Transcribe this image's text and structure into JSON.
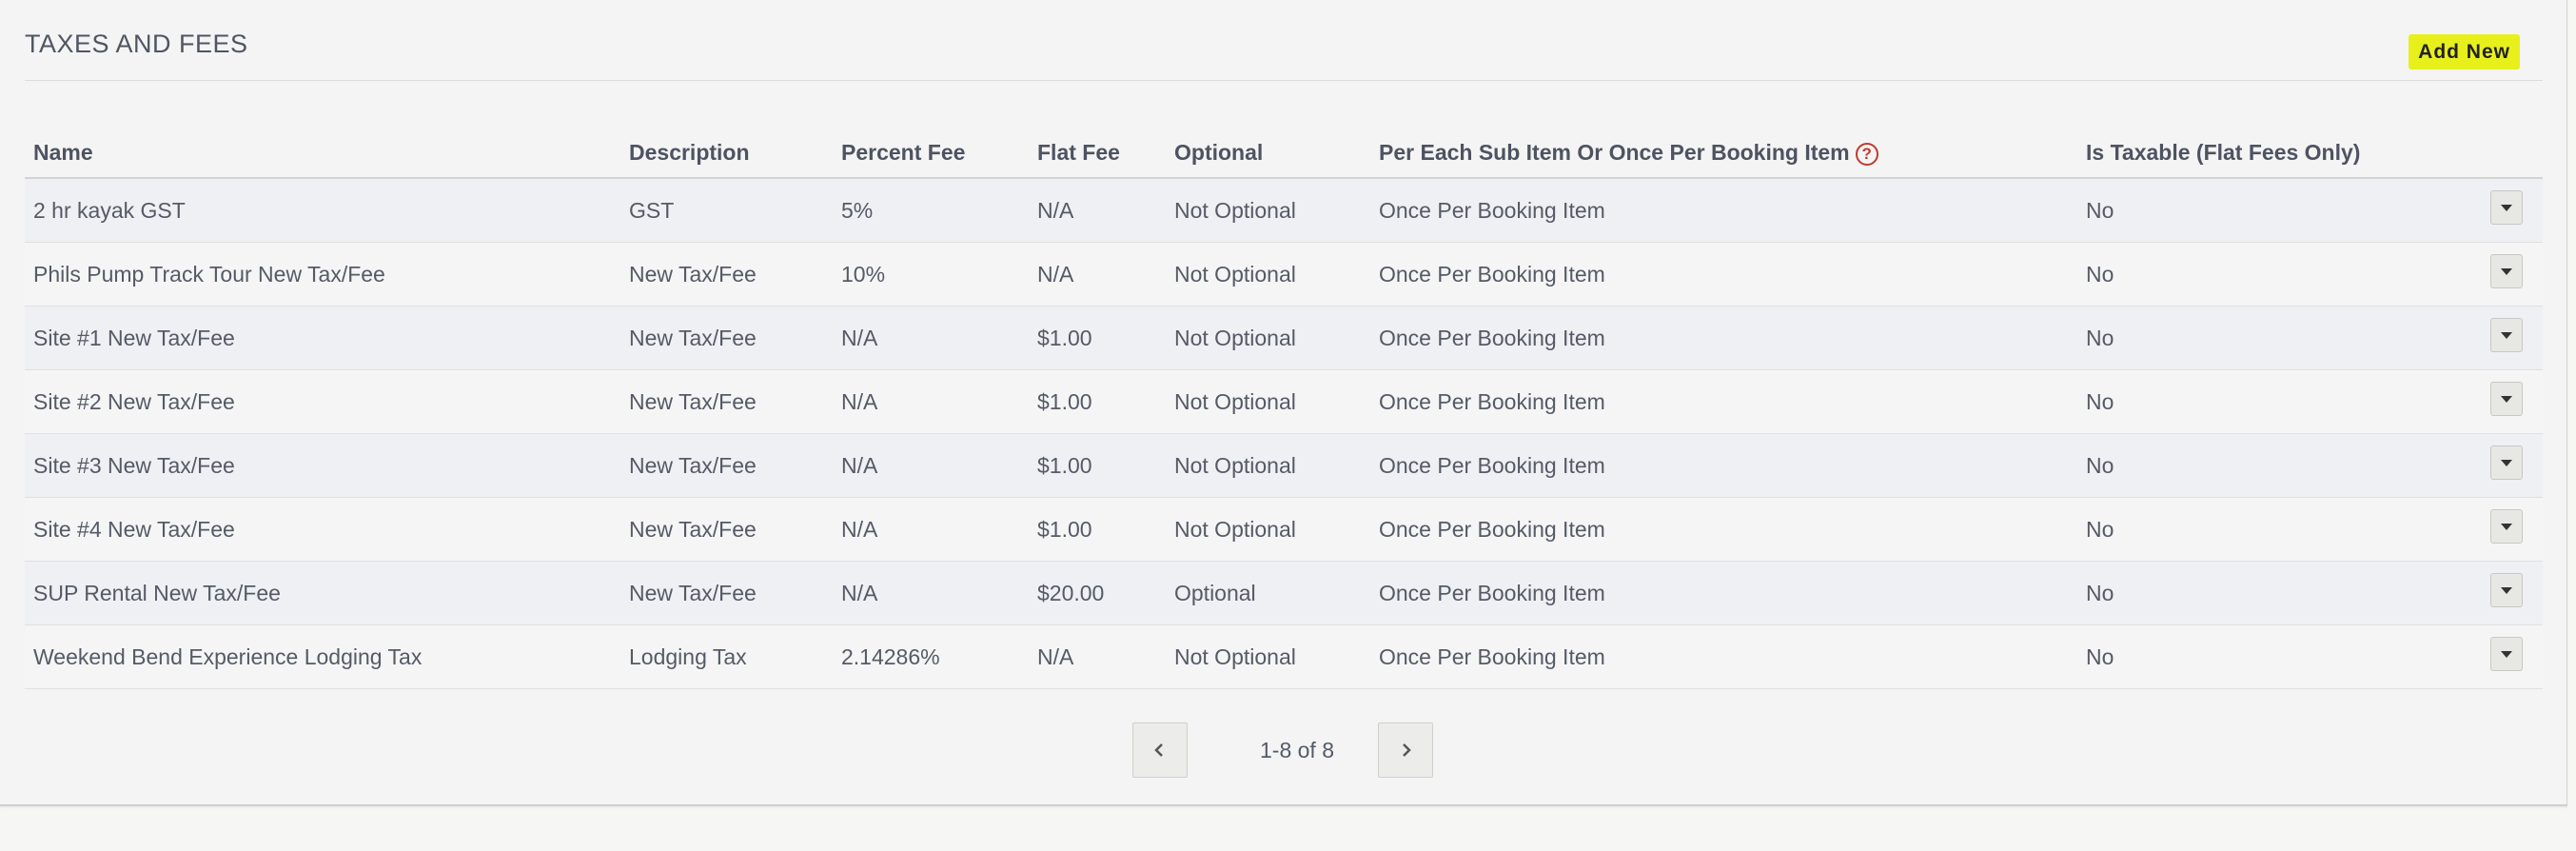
{
  "section": {
    "title": "TAXES AND FEES",
    "add_new_label": "Add New"
  },
  "table": {
    "columns": [
      "Name",
      "Description",
      "Percent Fee",
      "Flat Fee",
      "Optional",
      "Per Each Sub Item Or Once Per Booking Item",
      "Is Taxable (Flat Fees Only)"
    ],
    "help_icon_glyph": "?",
    "rows": [
      {
        "name": "2 hr kayak GST",
        "description": "GST",
        "percent_fee": "5%",
        "flat_fee": "N/A",
        "optional": "Not Optional",
        "per_item": "Once Per Booking Item",
        "taxable": "No"
      },
      {
        "name": "Phils Pump Track Tour New Tax/Fee",
        "description": "New Tax/Fee",
        "percent_fee": "10%",
        "flat_fee": "N/A",
        "optional": "Not Optional",
        "per_item": "Once Per Booking Item",
        "taxable": "No"
      },
      {
        "name": "Site #1 New Tax/Fee",
        "description": "New Tax/Fee",
        "percent_fee": "N/A",
        "flat_fee": "$1.00",
        "optional": "Not Optional",
        "per_item": "Once Per Booking Item",
        "taxable": "No"
      },
      {
        "name": "Site #2 New Tax/Fee",
        "description": "New Tax/Fee",
        "percent_fee": "N/A",
        "flat_fee": "$1.00",
        "optional": "Not Optional",
        "per_item": "Once Per Booking Item",
        "taxable": "No"
      },
      {
        "name": "Site #3 New Tax/Fee",
        "description": "New Tax/Fee",
        "percent_fee": "N/A",
        "flat_fee": "$1.00",
        "optional": "Not Optional",
        "per_item": "Once Per Booking Item",
        "taxable": "No"
      },
      {
        "name": "Site #4 New Tax/Fee",
        "description": "New Tax/Fee",
        "percent_fee": "N/A",
        "flat_fee": "$1.00",
        "optional": "Not Optional",
        "per_item": "Once Per Booking Item",
        "taxable": "No"
      },
      {
        "name": "SUP Rental New Tax/Fee",
        "description": "New Tax/Fee",
        "percent_fee": "N/A",
        "flat_fee": "$20.00",
        "optional": "Optional",
        "per_item": "Once Per Booking Item",
        "taxable": "No"
      },
      {
        "name": "Weekend Bend Experience Lodging Tax",
        "description": "Lodging Tax",
        "percent_fee": "2.14286%",
        "flat_fee": "N/A",
        "optional": "Not Optional",
        "per_item": "Once Per Booking Item",
        "taxable": "No"
      }
    ]
  },
  "pagination": {
    "info": "1-8 of 8",
    "prev_icon": "chevron-left-icon",
    "next_icon": "chevron-right-icon"
  },
  "colors": {
    "accent_highlight": "#e8f01b",
    "help_icon": "#c0392b"
  }
}
